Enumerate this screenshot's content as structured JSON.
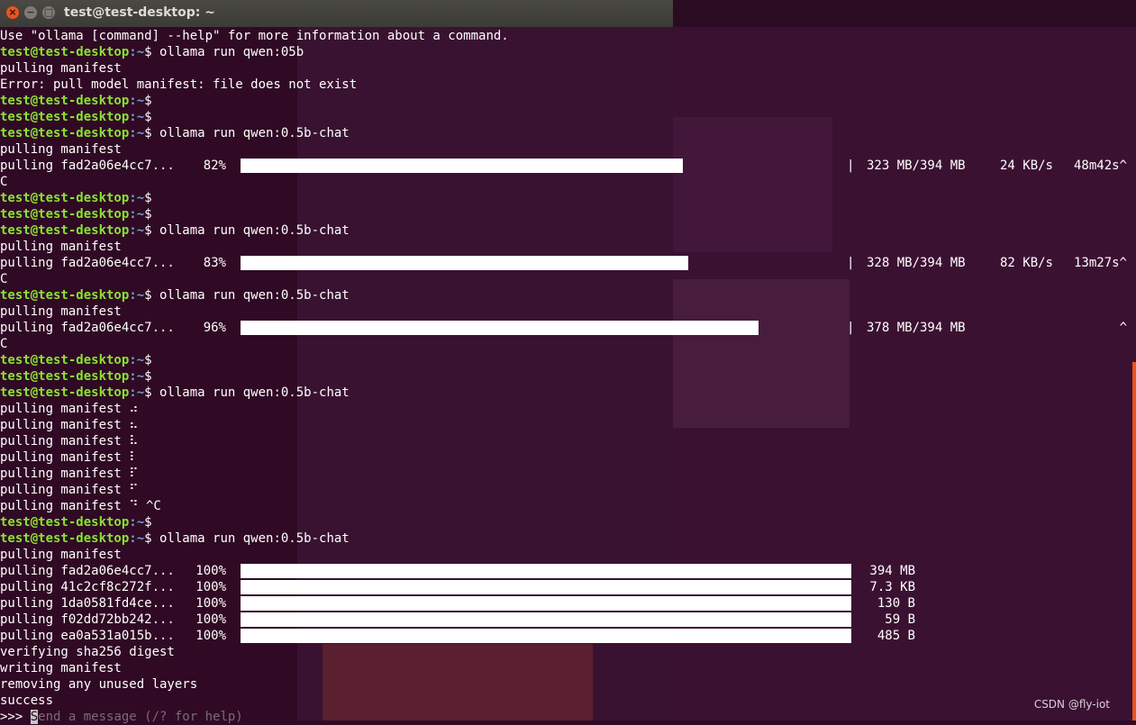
{
  "window": {
    "title": "test@test-desktop: ~",
    "close_glyph": "×",
    "minimize_glyph": "−",
    "maximize_glyph": "□"
  },
  "prompt": {
    "user_host": "test@test-desktop",
    "path": ":~",
    "symbol": "$ "
  },
  "lines": [
    {
      "type": "text",
      "text": "Use \"ollama [command] --help\" for more information about a command."
    },
    {
      "type": "prompt",
      "cmd": "ollama run qwen:05b"
    },
    {
      "type": "text",
      "text": "pulling manifest"
    },
    {
      "type": "text",
      "text": "Error: pull model manifest: file does not exist"
    },
    {
      "type": "prompt",
      "cmd": ""
    },
    {
      "type": "prompt",
      "cmd": ""
    },
    {
      "type": "prompt",
      "cmd": "ollama run qwen:0.5b-chat"
    },
    {
      "type": "text",
      "text": "pulling manifest"
    },
    {
      "type": "progress",
      "label": "pulling fad2a06e4cc7...",
      "pct": "82%",
      "fill": 0.82,
      "sep": "|",
      "size": "323 MB/394 MB",
      "speed": "24 KB/s",
      "eta": "48m42s^"
    },
    {
      "type": "text",
      "text": "C"
    },
    {
      "type": "prompt",
      "cmd": ""
    },
    {
      "type": "prompt",
      "cmd": ""
    },
    {
      "type": "prompt",
      "cmd": "ollama run qwen:0.5b-chat"
    },
    {
      "type": "text",
      "text": "pulling manifest"
    },
    {
      "type": "progress",
      "label": "pulling fad2a06e4cc7...",
      "pct": "83%",
      "fill": 0.83,
      "sep": "|",
      "size": "328 MB/394 MB",
      "speed": "82 KB/s",
      "eta": "13m27s^"
    },
    {
      "type": "text",
      "text": "C"
    },
    {
      "type": "prompt",
      "cmd": "ollama run qwen:0.5b-chat"
    },
    {
      "type": "text",
      "text": "pulling manifest"
    },
    {
      "type": "progress",
      "label": "pulling fad2a06e4cc7...",
      "pct": "96%",
      "fill": 0.96,
      "sep": "|",
      "size": "378 MB/394 MB",
      "speed": "",
      "eta": "^"
    },
    {
      "type": "text",
      "text": "C"
    },
    {
      "type": "prompt",
      "cmd": ""
    },
    {
      "type": "prompt",
      "cmd": ""
    },
    {
      "type": "prompt",
      "cmd": "ollama run qwen:0.5b-chat"
    },
    {
      "type": "text",
      "text": "pulling manifest ⠴"
    },
    {
      "type": "text",
      "text": "pulling manifest ⠦"
    },
    {
      "type": "text",
      "text": "pulling manifest ⠧"
    },
    {
      "type": "text",
      "text": "pulling manifest ⠇"
    },
    {
      "type": "text",
      "text": "pulling manifest ⠏"
    },
    {
      "type": "text",
      "text": "pulling manifest ⠋"
    },
    {
      "type": "text",
      "text": "pulling manifest ⠙ ^C"
    },
    {
      "type": "prompt",
      "cmd": ""
    },
    {
      "type": "prompt",
      "cmd": "ollama run qwen:0.5b-chat"
    },
    {
      "type": "text",
      "text": "pulling manifest"
    },
    {
      "type": "progress",
      "label": "pulling fad2a06e4cc7...",
      "pct": "100%",
      "fill": 1.0,
      "sep": "",
      "size": "394 MB",
      "speed": "",
      "eta": ""
    },
    {
      "type": "progress",
      "label": "pulling 41c2cf8c272f...",
      "pct": "100%",
      "fill": 1.0,
      "sep": "",
      "size": "7.3 KB",
      "speed": "",
      "eta": ""
    },
    {
      "type": "progress",
      "label": "pulling 1da0581fd4ce...",
      "pct": "100%",
      "fill": 1.0,
      "sep": "",
      "size": "130 B",
      "speed": "",
      "eta": ""
    },
    {
      "type": "progress",
      "label": "pulling f02dd72bb242...",
      "pct": "100%",
      "fill": 1.0,
      "sep": "",
      "size": "59 B",
      "speed": "",
      "eta": ""
    },
    {
      "type": "progress",
      "label": "pulling ea0a531a015b...",
      "pct": "100%",
      "fill": 1.0,
      "sep": "",
      "size": "485 B",
      "speed": "",
      "eta": ""
    },
    {
      "type": "text",
      "text": "verifying sha256 digest"
    },
    {
      "type": "text",
      "text": "writing manifest"
    },
    {
      "type": "text",
      "text": "removing any unused layers"
    },
    {
      "type": "text",
      "text": "success"
    },
    {
      "type": "input",
      "prompt": ">>> ",
      "cursor_char": "S",
      "placeholder": "end a message (/? for help)"
    }
  ],
  "watermark": "CSDN @fly-iot",
  "colors": {
    "background": "#300a24",
    "user": "#8ae234",
    "path": "#729fcf",
    "text": "#ffffff",
    "close_button": "#e9541f"
  }
}
